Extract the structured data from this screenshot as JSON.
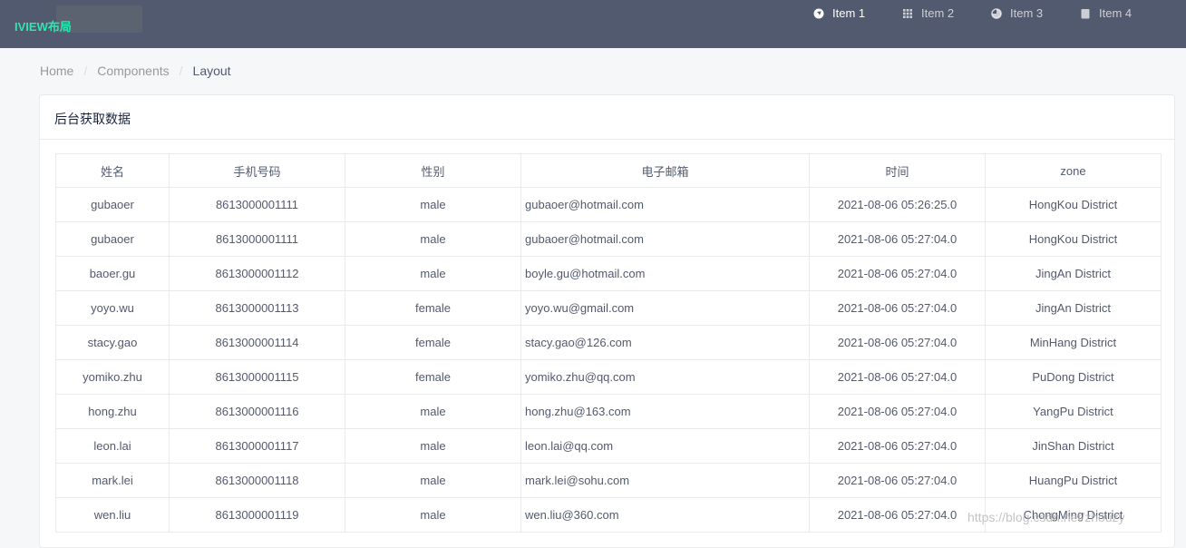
{
  "app": {
    "logo_text": "IVIEW布局"
  },
  "menu": [
    {
      "label": "Item 1",
      "icon": "navigation-icon"
    },
    {
      "label": "Item 2",
      "icon": "grid-icon"
    },
    {
      "label": "Item 3",
      "icon": "pie-chart-icon"
    },
    {
      "label": "Item 4",
      "icon": "document-icon"
    }
  ],
  "breadcrumb": {
    "home": "Home",
    "components": "Components",
    "layout": "Layout",
    "separator": "/"
  },
  "card": {
    "title": "后台获取数据"
  },
  "table": {
    "columns": [
      "姓名",
      "手机号码",
      "性别",
      "电子邮箱",
      "时间",
      "zone"
    ],
    "rows": [
      [
        "gubaoer",
        "8613000001111",
        "male",
        "gubaoer@hotmail.com",
        "2021-08-06 05:26:25.0",
        "HongKou District"
      ],
      [
        "gubaoer",
        "8613000001111",
        "male",
        "gubaoer@hotmail.com",
        "2021-08-06 05:27:04.0",
        "HongKou District"
      ],
      [
        "baoer.gu",
        "8613000001112",
        "male",
        "boyle.gu@hotmail.com",
        "2021-08-06 05:27:04.0",
        "JingAn District"
      ],
      [
        "yoyo.wu",
        "8613000001113",
        "female",
        "yoyo.wu@gmail.com",
        "2021-08-06 05:27:04.0",
        "JingAn District"
      ],
      [
        "stacy.gao",
        "8613000001114",
        "female",
        "stacy.gao@126.com",
        "2021-08-06 05:27:04.0",
        "MinHang District"
      ],
      [
        "yomiko.zhu",
        "8613000001115",
        "female",
        "yomiko.zhu@qq.com",
        "2021-08-06 05:27:04.0",
        "PuDong District"
      ],
      [
        "hong.zhu",
        "8613000001116",
        "male",
        "hong.zhu@163.com",
        "2021-08-06 05:27:04.0",
        "YangPu District"
      ],
      [
        "leon.lai",
        "8613000001117",
        "male",
        "leon.lai@qq.com",
        "2021-08-06 05:27:04.0",
        "JinShan District"
      ],
      [
        "mark.lei",
        "8613000001118",
        "male",
        "mark.lei@sohu.com",
        "2021-08-06 05:27:04.0",
        "HuangPu District"
      ],
      [
        "wen.liu",
        "8613000001119",
        "male",
        "wen.liu@360.com",
        "2021-08-06 05:27:04.0",
        "ChongMing District"
      ]
    ]
  },
  "watermark": "https://blog.csdn.net/zhouzy",
  "colors": {
    "header_bg": "#515a6e",
    "logo_text": "#2ee6b0",
    "page_bg": "#f5f7f9",
    "border": "#e8eaec"
  }
}
